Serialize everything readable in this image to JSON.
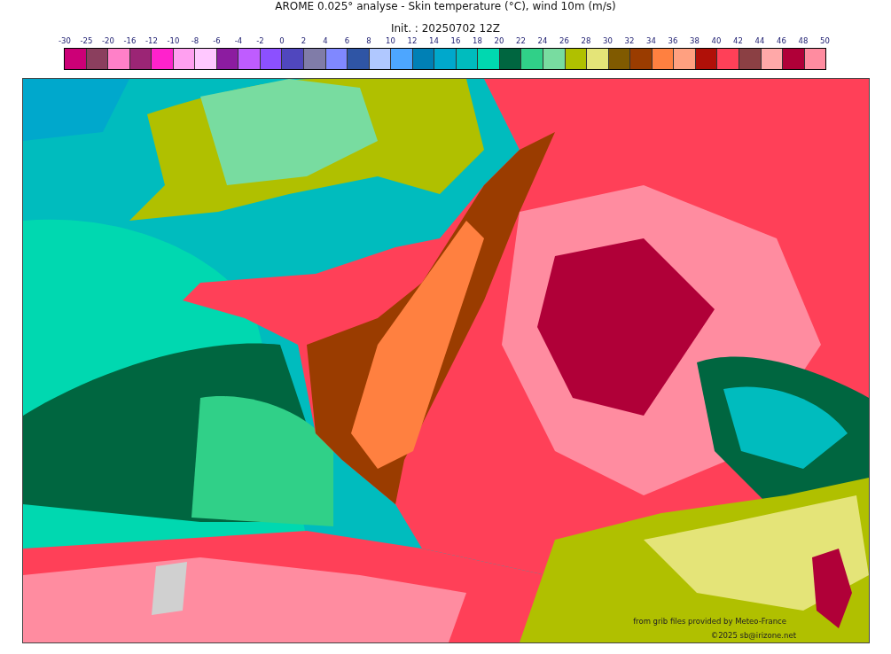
{
  "title": "AROME 0.025° analyse - Skin temperature (°C), wind 10m (m/s)",
  "subtitle": "Init. : 20250702 12Z",
  "colorbar": {
    "ticks": [
      "-30",
      "-25",
      "-20",
      "-16",
      "-12",
      "-10",
      "-8",
      "-6",
      "-4",
      "-2",
      "0",
      "2",
      "4",
      "6",
      "8",
      "10",
      "12",
      "14",
      "16",
      "18",
      "20",
      "22",
      "24",
      "26",
      "28",
      "30",
      "32",
      "34",
      "36",
      "38",
      "40",
      "42",
      "44",
      "46",
      "48",
      "50"
    ],
    "swatches": [
      {
        "color": "#cc0077"
      },
      {
        "color": "#8b3f5e"
      },
      {
        "color": "#ff80c8"
      },
      {
        "color": "#9b2575"
      },
      {
        "color": "#ff22cc"
      },
      {
        "color": "#ffa0f0"
      },
      {
        "color": "#ffc8ff"
      },
      {
        "color": "#8c1ca0"
      },
      {
        "color": "#bf5cff"
      },
      {
        "color": "#8c50ff"
      },
      {
        "color": "#5047be"
      },
      {
        "color": "#807ca8"
      },
      {
        "color": "#8088ff"
      },
      {
        "color": "#2f55a5"
      },
      {
        "color": "#b0c8ff"
      },
      {
        "color": "#4da6ff"
      },
      {
        "color": "#0080b5"
      },
      {
        "color": "#00a8cc"
      },
      {
        "color": "#00bcbe"
      },
      {
        "color": "#00d8b0"
      },
      {
        "color": "#006640"
      },
      {
        "color": "#30d088"
      },
      {
        "color": "#78dca0"
      },
      {
        "color": "#b0c000"
      },
      {
        "color": "#e4e478"
      },
      {
        "color": "#805a00"
      },
      {
        "color": "#9a3c00"
      },
      {
        "color": "#ff8040"
      },
      {
        "color": "#ffa080"
      },
      {
        "color": "#b01008"
      },
      {
        "color": "#ff4058"
      },
      {
        "color": "#8b4044"
      },
      {
        "color": "#ffa8a8"
      },
      {
        "color": "#b00038"
      },
      {
        "color": "#ff8ca0"
      }
    ]
  },
  "credits": [
    "from grib files provided by Meteo-France",
    "©2025 sb@irizone.net"
  ]
}
